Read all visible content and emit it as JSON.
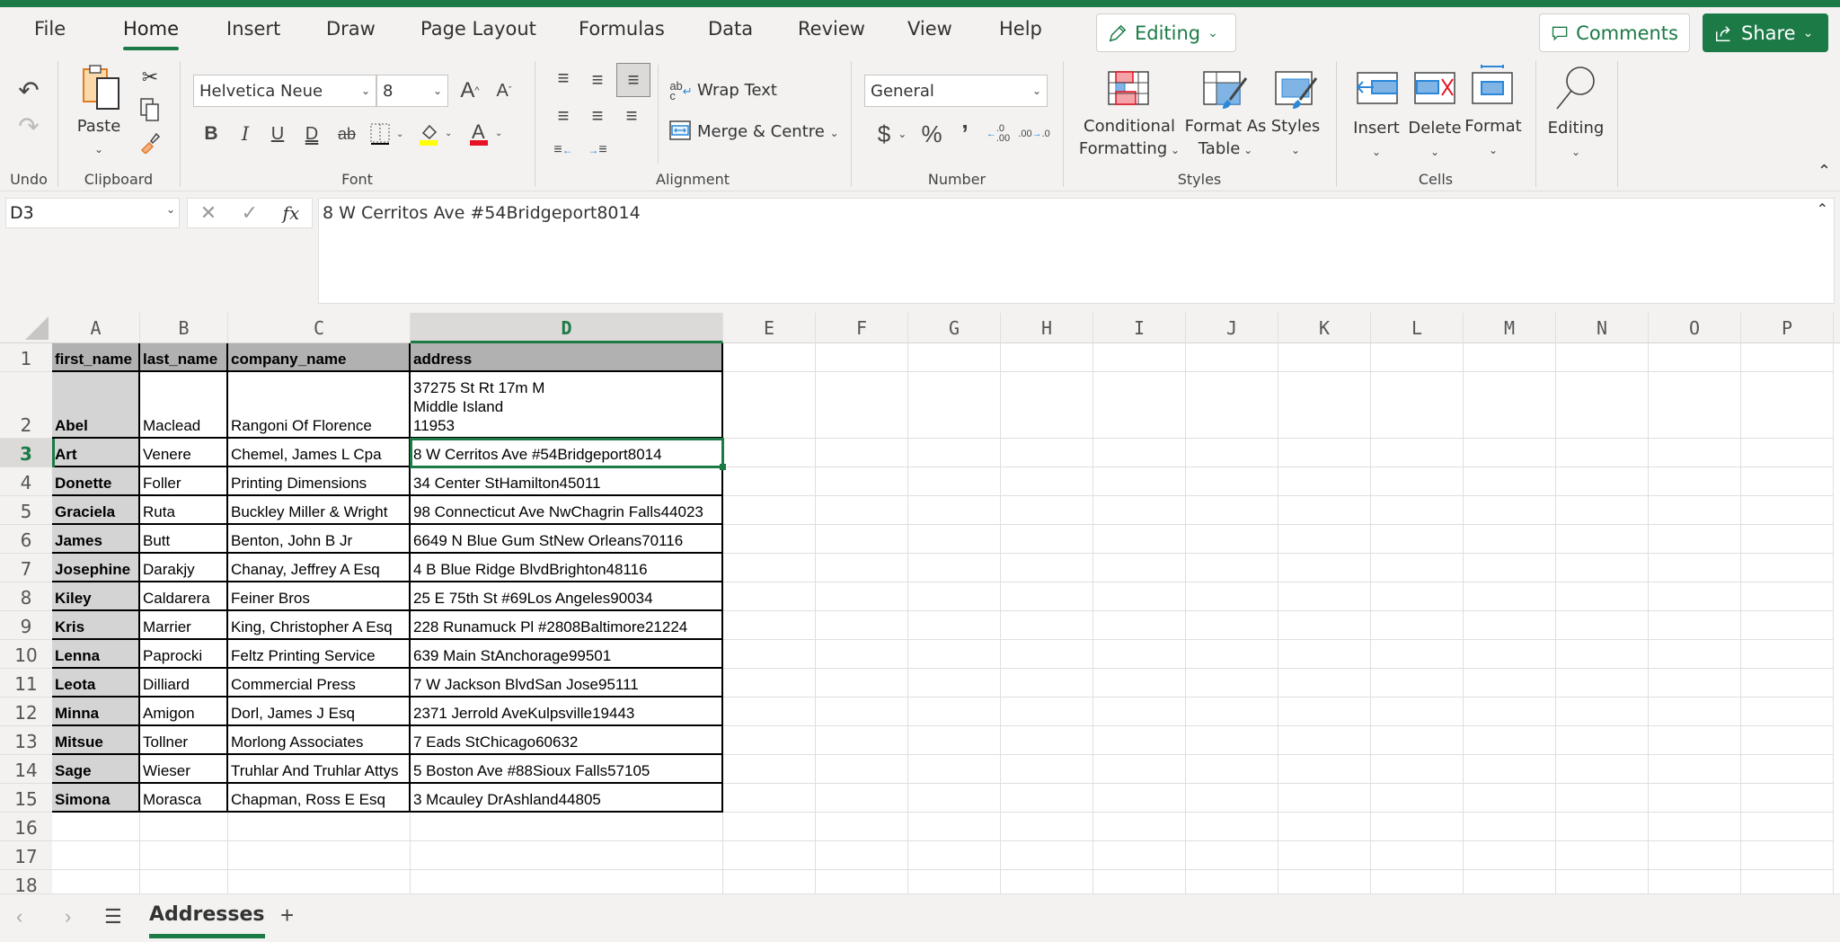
{
  "ribbon_tabs": [
    "File",
    "Home",
    "Insert",
    "Draw",
    "Page Layout",
    "Formulas",
    "Data",
    "Review",
    "View",
    "Help"
  ],
  "active_tab": "Home",
  "mode_button": "Editing",
  "comments_button": "Comments",
  "share_button": "Share",
  "ribbon": {
    "undo_group": "Undo",
    "clipboard_group": "Clipboard",
    "paste_label": "Paste",
    "font_group": "Font",
    "font_name": "Helvetica Neue",
    "font_size": "8",
    "alignment_group": "Alignment",
    "wrap_text": "Wrap Text",
    "merge_centre": "Merge & Centre",
    "number_group": "Number",
    "number_format": "General",
    "styles_group": "Styles",
    "conditional_formatting_1": "Conditional",
    "conditional_formatting_2": "Formatting",
    "format_as_table_1": "Format As",
    "format_as_table_2": "Table",
    "styles_label": "Styles",
    "cells_group": "Cells",
    "insert_label": "Insert",
    "delete_label": "Delete",
    "format_label": "Format",
    "editing_label": "Editing",
    "colors": {
      "accent": "#1b7a46",
      "highlight": "#ffff00",
      "font_color": "#e81123"
    }
  },
  "formula_bar": {
    "name_box": "D3",
    "fx": "fx",
    "value": "8 W Cerritos Ave #54Bridgeport8014"
  },
  "columns": [
    "A",
    "B",
    "C",
    "D",
    "E",
    "F",
    "G",
    "H",
    "I",
    "J",
    "K",
    "L",
    "M",
    "N",
    "O",
    "P"
  ],
  "selected_column": "D",
  "selected_row": "3",
  "rows": [
    "1",
    "2",
    "3",
    "4",
    "5",
    "6",
    "7",
    "8",
    "9",
    "10",
    "11",
    "12",
    "13",
    "14",
    "15",
    "16",
    "17",
    "18"
  ],
  "table": {
    "headers": [
      "first_name",
      "last_name",
      "company_name",
      "address"
    ],
    "data": [
      [
        "Abel",
        "Maclead",
        "Rangoni Of Florence",
        "37275 St  Rt 17m M\nMiddle Island\n11953"
      ],
      [
        "Art",
        "Venere",
        "Chemel, James L Cpa",
        "8 W Cerritos Ave #54Bridgeport8014"
      ],
      [
        "Donette",
        "Foller",
        "Printing Dimensions",
        "34 Center StHamilton45011"
      ],
      [
        "Graciela",
        "Ruta",
        "Buckley Miller & Wright",
        "98 Connecticut Ave NwChagrin Falls44023"
      ],
      [
        "James",
        "Butt",
        "Benton, John B Jr",
        "6649 N Blue Gum StNew Orleans70116"
      ],
      [
        "Josephine",
        "Darakjy",
        "Chanay, Jeffrey A Esq",
        "4 B Blue Ridge BlvdBrighton48116"
      ],
      [
        "Kiley",
        "Caldarera",
        "Feiner Bros",
        "25 E 75th St #69Los Angeles90034"
      ],
      [
        "Kris",
        "Marrier",
        "King, Christopher A Esq",
        "228 Runamuck Pl #2808Baltimore21224"
      ],
      [
        "Lenna",
        "Paprocki",
        "Feltz Printing Service",
        "639 Main StAnchorage99501"
      ],
      [
        "Leota",
        "Dilliard",
        "Commercial Press",
        "7 W Jackson BlvdSan Jose95111"
      ],
      [
        "Minna",
        "Amigon",
        "Dorl, James J Esq",
        "2371 Jerrold AveKulpsville19443"
      ],
      [
        "Mitsue",
        "Tollner",
        "Morlong Associates",
        "7 Eads StChicago60632"
      ],
      [
        "Sage",
        "Wieser",
        "Truhlar And Truhlar Attys",
        "5 Boston Ave #88Sioux Falls57105"
      ],
      [
        "Simona",
        "Morasca",
        "Chapman, Ross E Esq",
        "3 Mcauley DrAshland44805"
      ]
    ]
  },
  "sheet_tabs": [
    "Addresses"
  ],
  "add_sheet": "+"
}
